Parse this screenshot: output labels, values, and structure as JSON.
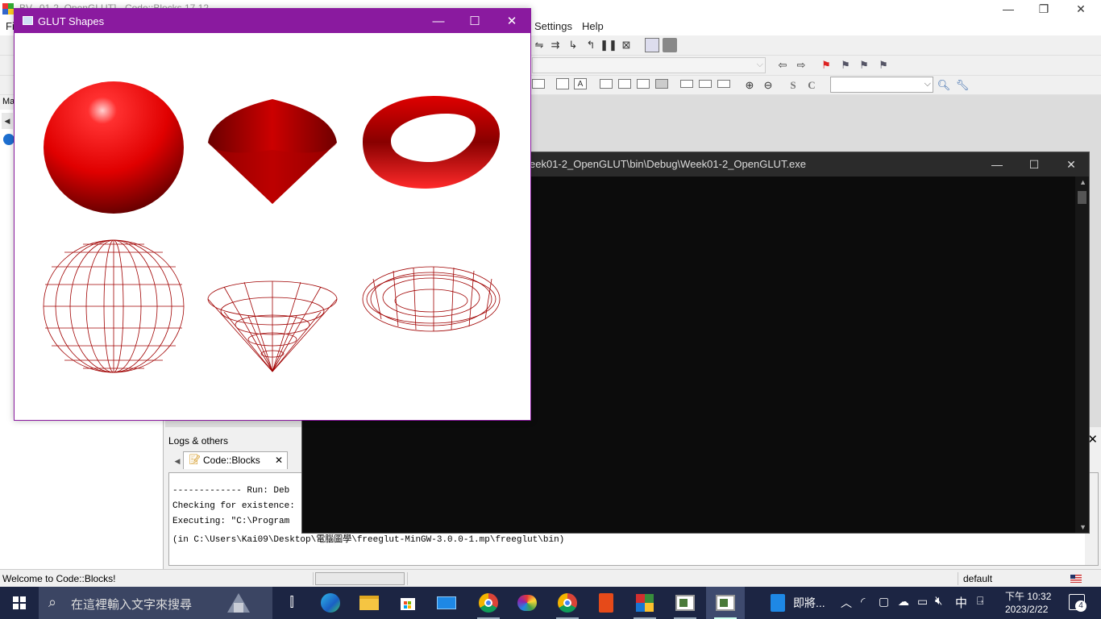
{
  "codeblocks": {
    "title": "BV...01-2_OpenGLUT] - Code::Blocks 17.12",
    "menu": {
      "first_letter": "Fi",
      "settings": "Settings",
      "help": "Help"
    },
    "left_panel_tab": "Ma",
    "logs": {
      "title": "Logs & others",
      "tab_label": "Code::Blocks",
      "lines": [
        "------------- Run: Deb",
        "Checking for existence:",
        "Executing: \"C:\\Program ",
        "(in C:\\Users\\Kai09\\Desktop\\電腦圖學\\freeglut-MinGW-3.0.0-1.mp\\freeglut\\bin)"
      ]
    },
    "status": {
      "message": "Welcome to Code::Blocks!",
      "default": "default"
    }
  },
  "console": {
    "title": "eek01-2_OpenGLUT\\bin\\Debug\\Week01-2_OpenGLUT.exe"
  },
  "glut_window": {
    "title": "GLUT Shapes",
    "shapes": [
      "solid-sphere",
      "solid-cone",
      "solid-torus",
      "wire-sphere",
      "wire-cone",
      "wire-torus"
    ],
    "shape_color": "#ff0000"
  },
  "taskbar": {
    "search_placeholder": "在這裡輸入文字來搜尋",
    "app_label": "即將...",
    "ime": "中",
    "time": "下午 10:32",
    "date": "2023/2/22",
    "notification_count": "4",
    "colors": {
      "background": "#1c2543",
      "search": "#3b4563"
    }
  }
}
